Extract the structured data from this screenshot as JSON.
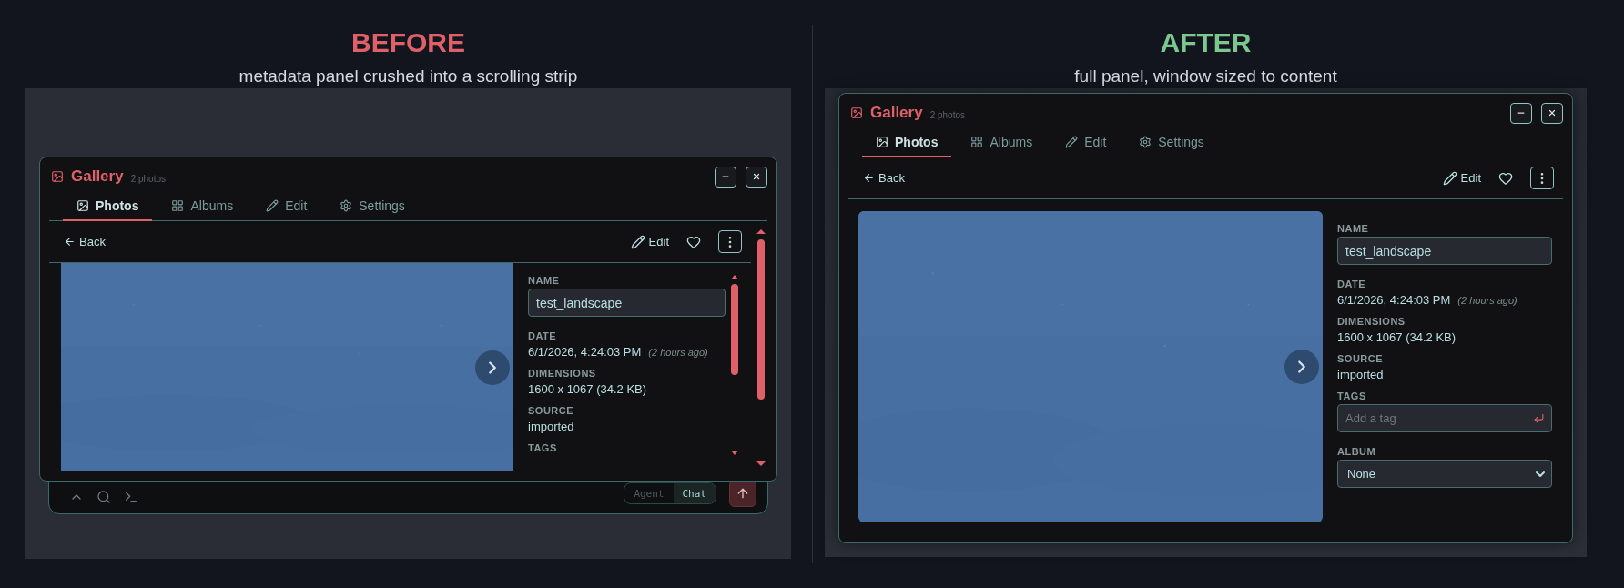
{
  "panels": [
    {
      "kind": "crushed",
      "heading": "BEFORE",
      "subtitle": "metadata panel crushed into a scrolling strip",
      "window": {
        "title": "Gallery",
        "count": "2 photos",
        "tabs": [
          {
            "label": "Photos",
            "selected": true
          },
          {
            "label": "Albums",
            "selected": false
          },
          {
            "label": "Edit",
            "selected": false
          },
          {
            "label": "Settings",
            "selected": false
          }
        ],
        "back": "Back",
        "edit": "Edit",
        "fields": [
          {
            "kind": "input",
            "label": "NAME",
            "value": "test_landscape"
          },
          {
            "kind": "text",
            "label": "DATE",
            "value": "6/1/2026, 4:24:03 PM",
            "note": "(2 hours ago)"
          },
          {
            "kind": "text",
            "label": "DIMENSIONS",
            "value": "1600 x 1067 (34.2 KB)"
          },
          {
            "kind": "text",
            "label": "SOURCE",
            "value": "imported"
          },
          {
            "kind": "label",
            "label": "TAGS"
          }
        ]
      },
      "chat_bar": {
        "modes": [
          {
            "label": "Agent",
            "selected": false
          },
          {
            "label": "Chat",
            "selected": true
          }
        ]
      }
    },
    {
      "kind": "full",
      "heading": "AFTER",
      "subtitle": "full panel, window sized to content",
      "window": {
        "title": "Gallery",
        "count": "2 photos",
        "tabs": [
          {
            "label": "Photos",
            "selected": true
          },
          {
            "label": "Albums",
            "selected": false
          },
          {
            "label": "Edit",
            "selected": false
          },
          {
            "label": "Settings",
            "selected": false
          }
        ],
        "back": "Back",
        "edit": "Edit",
        "fields": [
          {
            "kind": "input",
            "label": "NAME",
            "value": "test_landscape"
          },
          {
            "kind": "text",
            "label": "DATE",
            "value": "6/1/2026, 4:24:03 PM",
            "note": "(2 hours ago)"
          },
          {
            "kind": "text",
            "label": "DIMENSIONS",
            "value": "1600 x 1067 (34.2 KB)"
          },
          {
            "kind": "text",
            "label": "SOURCE",
            "value": "imported"
          },
          {
            "kind": "tag_input",
            "label": "TAGS",
            "placeholder": "Add a tag"
          },
          {
            "kind": "select",
            "label": "ALBUM",
            "value": "None"
          }
        ]
      }
    }
  ]
}
